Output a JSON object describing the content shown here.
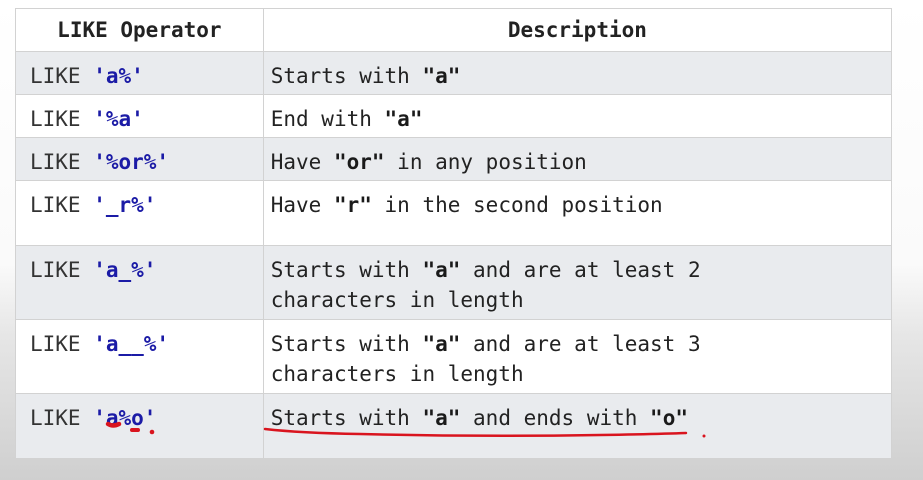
{
  "table": {
    "headers": [
      "LIKE Operator",
      "Description"
    ],
    "rows": [
      {
        "keyword": "LIKE",
        "pattern": "'a%'",
        "desc_lines": [
          [
            {
              "t": "Starts with "
            },
            {
              "t": "\"a\"",
              "b": true
            }
          ]
        ]
      },
      {
        "keyword": "LIKE",
        "pattern": "'%a'",
        "desc_lines": [
          [
            {
              "t": "End with "
            },
            {
              "t": "\"a\"",
              "b": true
            }
          ]
        ]
      },
      {
        "keyword": "LIKE",
        "pattern": "'%or%'",
        "desc_lines": [
          [
            {
              "t": "Have "
            },
            {
              "t": "\"or\"",
              "b": true
            },
            {
              "t": " in any position"
            }
          ]
        ]
      },
      {
        "keyword": "LIKE",
        "pattern": "'_r%'",
        "desc_lines": [
          [
            {
              "t": "Have "
            },
            {
              "t": "\"r\"",
              "b": true
            },
            {
              "t": " in the second position"
            }
          ]
        ]
      },
      {
        "keyword": "LIKE",
        "pattern": "'a_%'",
        "desc_lines": [
          [
            {
              "t": "Starts with "
            },
            {
              "t": "\"a\"",
              "b": true
            },
            {
              "t": " and are at least 2"
            }
          ],
          [
            {
              "t": "characters in length"
            }
          ]
        ]
      },
      {
        "keyword": "LIKE",
        "pattern": "'a__%'",
        "desc_lines": [
          [
            {
              "t": "Starts with "
            },
            {
              "t": "\"a\"",
              "b": true
            },
            {
              "t": " and are at least 3"
            }
          ],
          [
            {
              "t": "characters in length"
            }
          ]
        ]
      },
      {
        "keyword": "LIKE",
        "pattern": "'a%o'",
        "desc_lines": [
          [
            {
              "t": "Starts with "
            },
            {
              "t": "\"a\"",
              "b": true
            },
            {
              "t": " and ends with "
            },
            {
              "t": "\"o\"",
              "b": true
            }
          ]
        ]
      }
    ]
  },
  "annotation": {
    "color": "#d9141e"
  }
}
